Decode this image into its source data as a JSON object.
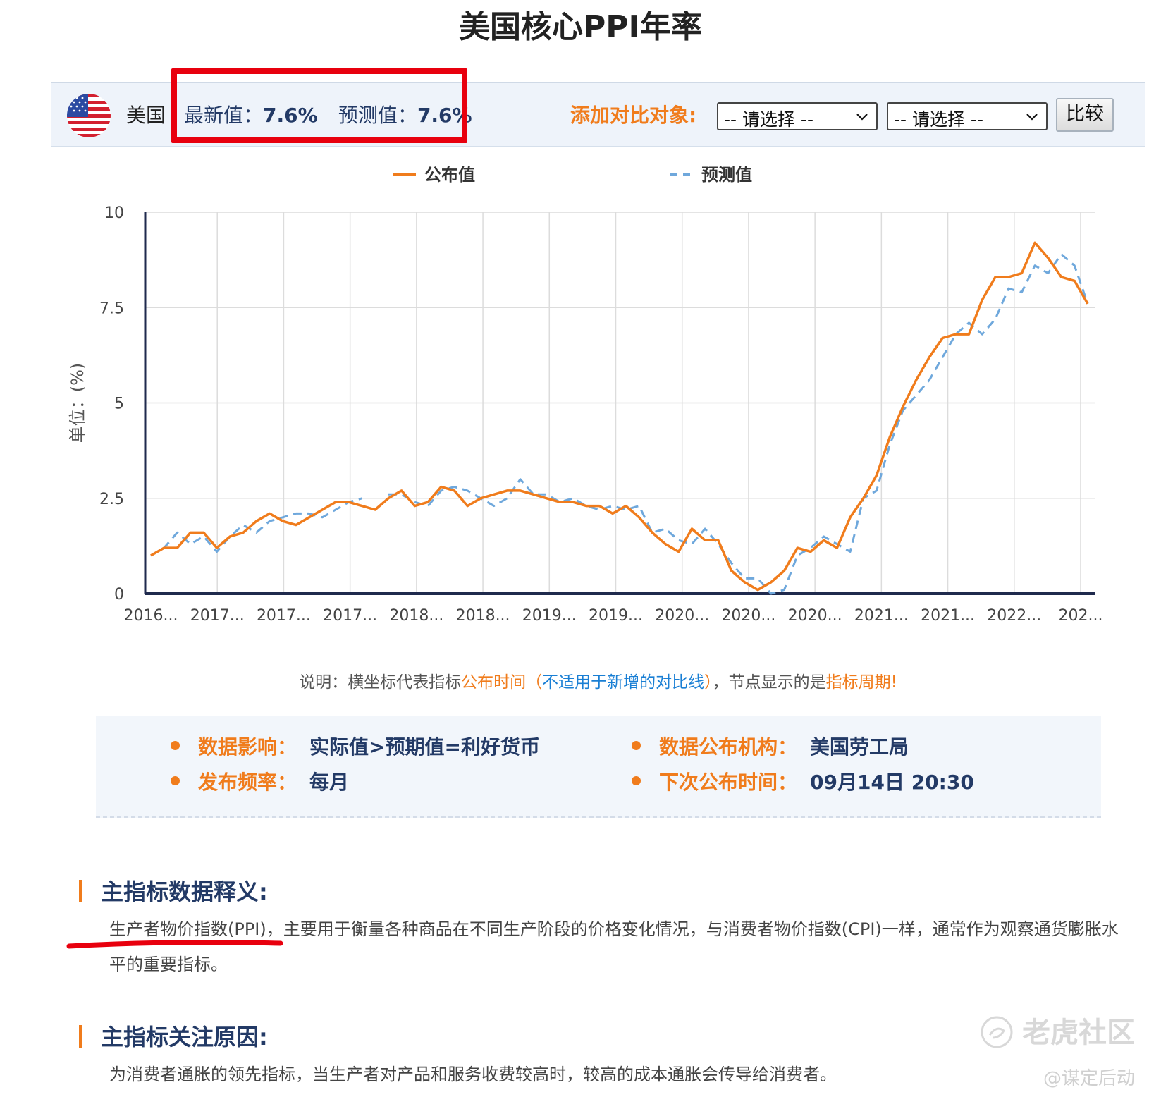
{
  "page": {
    "title": "美国核心PPI年率"
  },
  "header": {
    "country": "美国",
    "latest_label": "最新值：",
    "latest_value": "7.6%",
    "forecast_label": "预测值：",
    "forecast_value": "7.6%",
    "compare_label": "添加对比对象:",
    "select1": "-- 请选择 --",
    "select2": "-- 请选择 --",
    "compare_button": "比较",
    "icons": {
      "flag": "us-flag-icon",
      "chevron": "chevron-down-icon"
    }
  },
  "chart_data": {
    "type": "line",
    "ylabel": "单位：(%)",
    "xlabel": "",
    "ylim": [
      0,
      10
    ],
    "yticks": [
      0,
      2.5,
      5,
      7.5,
      10
    ],
    "ytick_labels": [
      "0",
      "2.5",
      "5",
      "7.5",
      "10"
    ],
    "xtick_labels": [
      "2016...",
      "2017...",
      "2017...",
      "2017...",
      "2018...",
      "2018...",
      "2019...",
      "2019...",
      "2020...",
      "2020...",
      "2020...",
      "2021...",
      "2021...",
      "2022...",
      "202..."
    ],
    "grid": true,
    "legend_placement": "top",
    "series": [
      {
        "name": "公布值",
        "color": "#f07c1c",
        "dash": false,
        "values": [
          1.0,
          1.2,
          1.2,
          1.6,
          1.6,
          1.2,
          1.5,
          1.6,
          1.9,
          2.1,
          1.9,
          1.8,
          2.0,
          2.2,
          2.4,
          2.4,
          2.3,
          2.2,
          2.5,
          2.7,
          2.3,
          2.4,
          2.8,
          2.7,
          2.3,
          2.5,
          2.6,
          2.7,
          2.7,
          2.6,
          2.5,
          2.4,
          2.4,
          2.3,
          2.3,
          2.1,
          2.3,
          2.0,
          1.6,
          1.3,
          1.1,
          1.7,
          1.4,
          1.4,
          0.6,
          0.3,
          0.1,
          0.3,
          0.6,
          1.2,
          1.1,
          1.4,
          1.2,
          2.0,
          2.5,
          3.1,
          4.1,
          4.9,
          5.6,
          6.2,
          6.7,
          6.8,
          6.8,
          7.7,
          8.3,
          8.3,
          8.4,
          9.2,
          8.8,
          8.3,
          8.2,
          7.6
        ]
      },
      {
        "name": "预测值",
        "color": "#6fa8dc",
        "dash": true,
        "values": [
          1.0,
          1.2,
          1.6,
          1.3,
          1.5,
          1.1,
          1.5,
          1.8,
          1.6,
          1.9,
          2.0,
          2.1,
          2.1,
          2.0,
          2.2,
          2.4,
          2.5,
          null,
          2.6,
          2.6,
          2.4,
          2.3,
          2.7,
          2.8,
          2.7,
          2.5,
          2.3,
          2.5,
          3.0,
          2.6,
          2.6,
          2.4,
          2.5,
          2.3,
          2.2,
          2.3,
          2.2,
          2.3,
          1.6,
          1.7,
          1.4,
          1.3,
          1.7,
          1.3,
          0.8,
          0.4,
          0.4,
          0.0,
          0.1,
          1.0,
          1.2,
          1.5,
          1.3,
          1.1,
          2.5,
          2.7,
          3.9,
          4.8,
          5.2,
          5.6,
          6.2,
          6.8,
          7.1,
          6.8,
          7.2,
          8.0,
          7.9,
          8.6,
          8.4,
          8.9,
          8.6,
          7.6
        ]
      }
    ]
  },
  "note": {
    "prefix": "说明：横坐标代表指标",
    "orange1": "公布时间",
    "blue_open": "（",
    "blue": "不适用于新增的对比线",
    "blue_close": "）",
    "middle": "，节点显示的是",
    "orange2": "指标周期!"
  },
  "info": {
    "impact_label": "数据影响：",
    "impact_value": "实际值>预期值=利好货币",
    "agency_label": "数据公布机构：",
    "agency_value": "美国劳工局",
    "freq_label": "发布频率：",
    "freq_value": "每月",
    "next_label": "下次公布时间：",
    "next_value": "09月14日 20:30"
  },
  "sections": {
    "def_title": "主指标数据释义:",
    "def_text": "生产者物价指数(PPI)，主要用于衡量各种商品在不同生产阶段的价格变化情况，与消费者物价指数(CPI)一样，通常作为观察通货膨胀水平的重要指标。",
    "reason_title": "主指标关注原因:",
    "reason_text": "为消费者通胀的领先指标，当生产者对产品和服务收费较高时，较高的成本通胀会传导给消费者。"
  },
  "watermark": {
    "text": "老虎社区",
    "author": "@谋定后动"
  }
}
